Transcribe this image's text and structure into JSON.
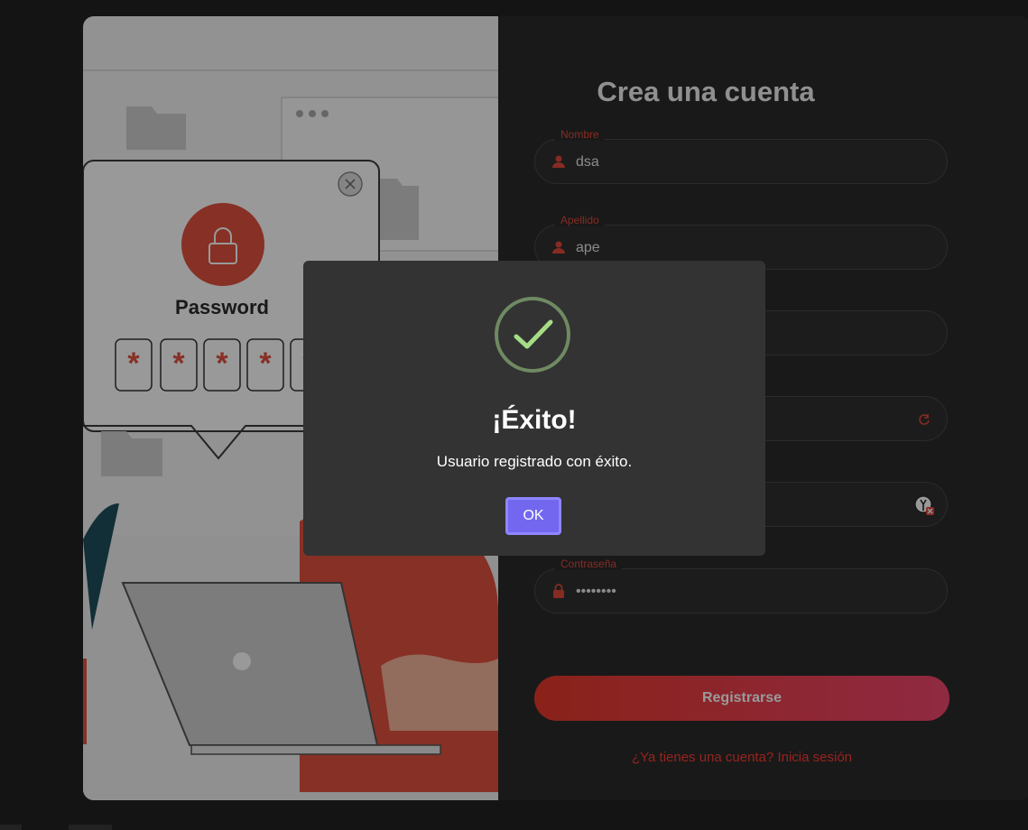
{
  "form": {
    "title": "Crea una cuenta",
    "fields": [
      {
        "label": "Nombre",
        "value": "dsa"
      },
      {
        "label": "Apellido",
        "value": "ape"
      },
      {
        "label": "",
        "value": ""
      },
      {
        "label": "",
        "value": ""
      },
      {
        "label": "",
        "value": ""
      },
      {
        "label": "Contraseña",
        "value": "••••••••"
      }
    ],
    "register_label": "Registrarse",
    "login_link": "¿Ya tienes una cuenta? Inicia sesión"
  },
  "illustration": {
    "password_heading": "Password",
    "star_chars": [
      "*",
      "*",
      "*",
      "*",
      "*"
    ]
  },
  "dialog": {
    "title": "¡Éxito!",
    "message": "Usuario registrado con éxito.",
    "ok_label": "OK"
  },
  "colors": {
    "accent": "#e0483a",
    "ok_button": "#7367f0",
    "check": "#a5dc86"
  }
}
